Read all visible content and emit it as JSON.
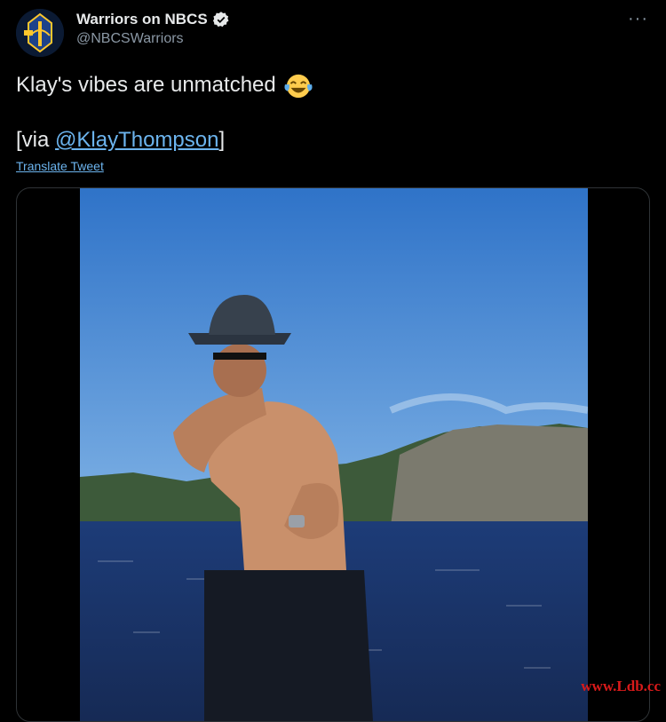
{
  "tweet": {
    "display_name": "Warriors on NBCS",
    "handle": "@NBCSWarriors",
    "more_icon": "ellipsis-icon",
    "text_line1": "Klay's vibes are unmatched",
    "emoji": "face-with-tears-of-joy",
    "via_prefix": "[via ",
    "via_mention": "@KlayThompson",
    "via_suffix": "]",
    "translate_label": "Translate Tweet",
    "verified_icon": "verified-badge-icon"
  },
  "media": {
    "type": "video",
    "description_icon": "video-frame"
  },
  "watermark": "www.Ldb.cc",
  "colors": {
    "background": "#000000",
    "text": "#e7e9ea",
    "secondary": "#8b98a5",
    "link": "#6cb4ee"
  }
}
